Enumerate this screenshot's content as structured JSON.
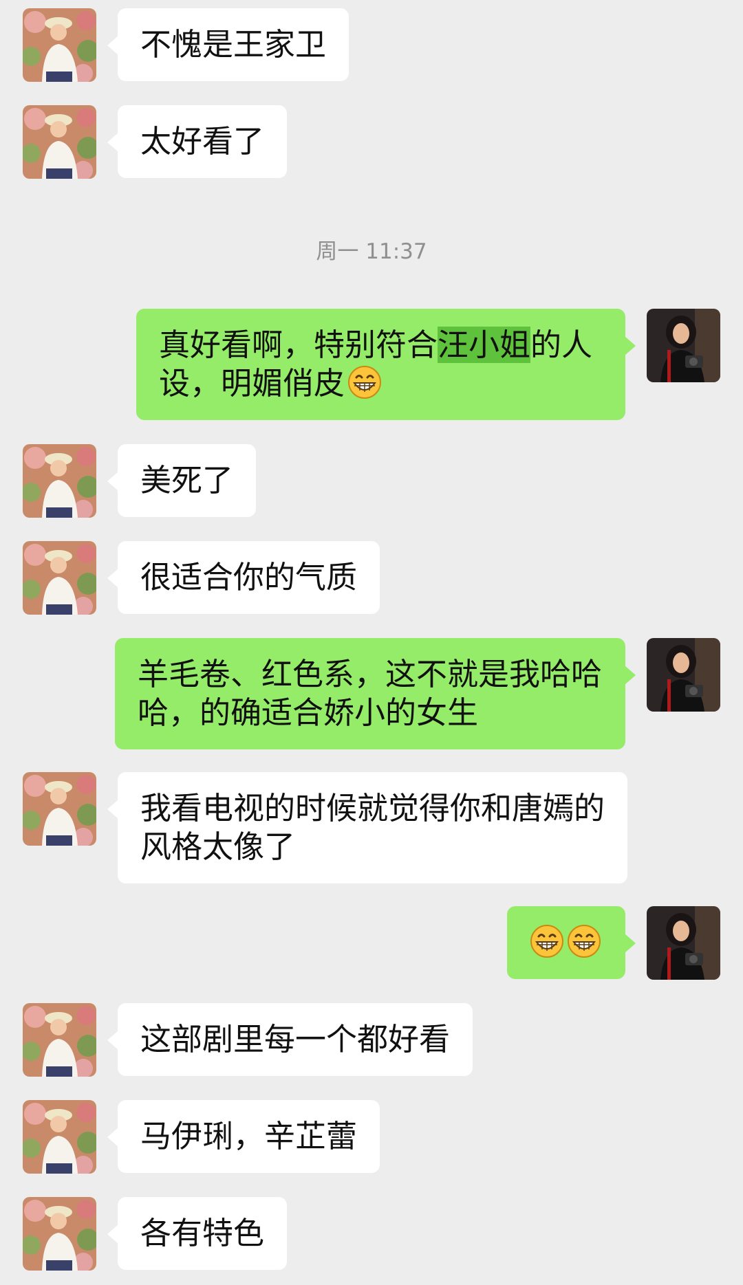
{
  "timestamp": "周一 11:37",
  "messages": [
    {
      "side": "in",
      "text": "不愧是王家卫"
    },
    {
      "side": "in",
      "text": "太好看了"
    },
    {
      "side": "out",
      "line1_pre": "真好看啊，特别符合",
      "line1_hl": "汪小姐",
      "line1_post": "的人",
      "line2": "设，明媚俏皮",
      "emoji": "grinning-face-emoji"
    },
    {
      "side": "in",
      "text": "美死了"
    },
    {
      "side": "in",
      "text": "很适合你的气质"
    },
    {
      "side": "out",
      "line1": "羊毛卷、红色系，这不就是我哈哈",
      "line2": "哈，的确适合娇小的女生"
    },
    {
      "side": "in",
      "line1": "我看电视的时候就觉得你和唐嫣的",
      "line2": "风格太像了"
    },
    {
      "side": "out",
      "emoji_count": 2,
      "emoji": "grinning-face-emoji"
    },
    {
      "side": "in",
      "text": "这部剧里每一个都好看"
    },
    {
      "side": "in",
      "text": "马伊琍，辛芷蕾"
    },
    {
      "side": "in",
      "text": "各有特色"
    }
  ],
  "colors": {
    "background": "#ededed",
    "incoming_bubble": "#ffffff",
    "outgoing_bubble": "#95ec69",
    "highlight": "#5fc23d",
    "timestamp_text": "#8f8f8f"
  }
}
